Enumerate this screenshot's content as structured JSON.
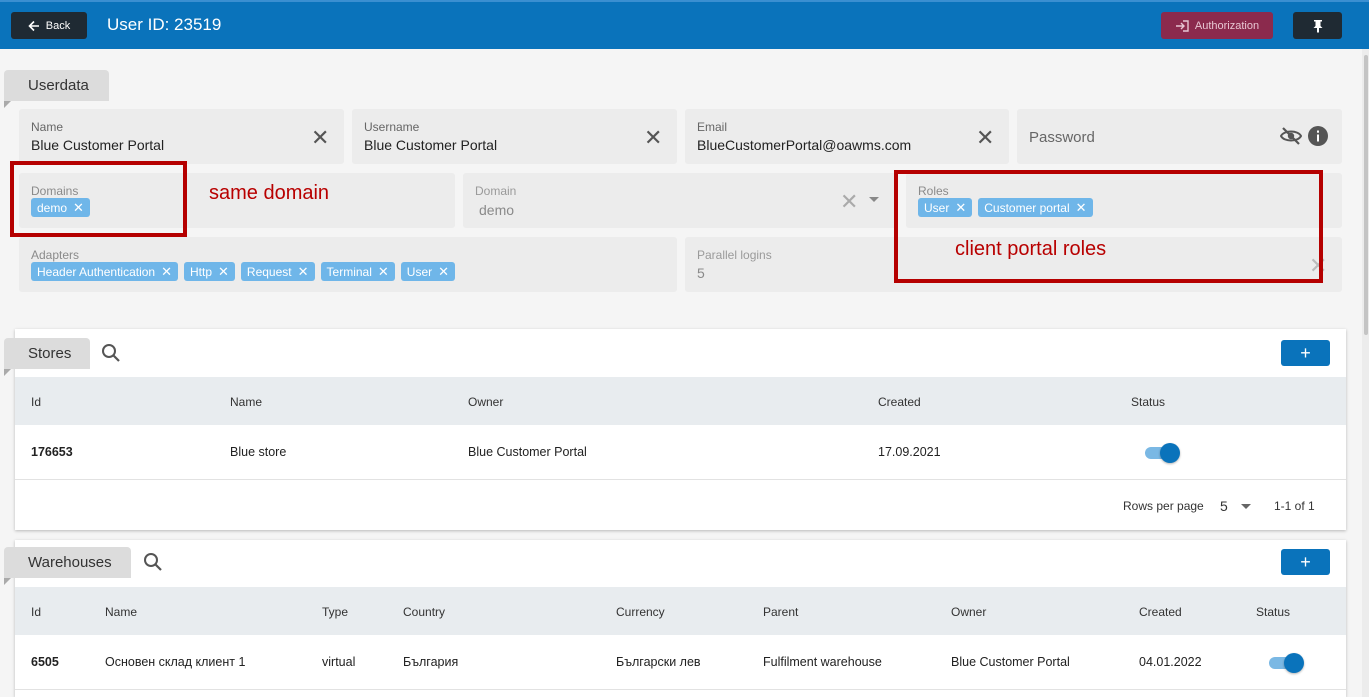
{
  "header": {
    "back_label": "Back",
    "title": "User ID: 23519",
    "authorization_label": "Authorization"
  },
  "userdata": {
    "section_title": "Userdata",
    "name": {
      "label": "Name",
      "value": "Blue Customer Portal"
    },
    "username": {
      "label": "Username",
      "value": "Blue Customer Portal"
    },
    "email": {
      "label": "Email",
      "value": "BlueCustomerPortal@oawms.com"
    },
    "password": {
      "placeholder": "Password"
    },
    "domains": {
      "label": "Domains",
      "chips": [
        "demo"
      ]
    },
    "domain": {
      "label": "Domain",
      "value": "demo"
    },
    "roles": {
      "label": "Roles",
      "chips": [
        "User",
        "Customer portal"
      ]
    },
    "adapters": {
      "label": "Adapters",
      "chips": [
        "Header Authentication",
        "Http",
        "Request",
        "Terminal",
        "User"
      ]
    },
    "parallel_logins": {
      "label": "Parallel logins",
      "value": "5"
    }
  },
  "annotations": {
    "same_domain": "same domain",
    "client_portal_roles": "client portal roles",
    "color": "#b50000"
  },
  "stores": {
    "section_title": "Stores",
    "add_label": "+",
    "columns": [
      "Id",
      "Name",
      "Owner",
      "Created",
      "Status"
    ],
    "rows": [
      {
        "id": "176653",
        "name": "Blue store",
        "owner": "Blue Customer Portal",
        "created": "17.09.2021",
        "status": true
      }
    ],
    "rows_per_page_label": "Rows per page",
    "rows_per_page": "5",
    "range": "1-1 of 1"
  },
  "warehouses": {
    "section_title": "Warehouses",
    "add_label": "+",
    "columns": [
      "Id",
      "Name",
      "Type",
      "Country",
      "Currency",
      "Parent",
      "Owner",
      "Created",
      "Status"
    ],
    "rows": [
      {
        "id": "6505",
        "name": "Основен склад клиент 1",
        "type": "virtual",
        "country": "България",
        "currency": "Български лев",
        "parent": "Fulfilment warehouse",
        "owner": "Blue Customer Portal",
        "created": "04.01.2022",
        "status": true
      }
    ]
  },
  "colors": {
    "primary": "#0a73bb",
    "authorization": "#8b2a4d",
    "chip": "#6fb6e9"
  }
}
